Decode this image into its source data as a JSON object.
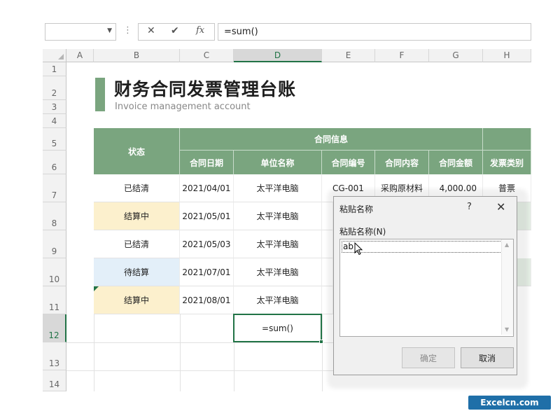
{
  "formula_bar": {
    "name_box": "",
    "dots": "⋮",
    "cancel": "✕",
    "enter": "✔",
    "fx": "fx",
    "formula": "=sum()"
  },
  "columns": [
    "A",
    "B",
    "C",
    "D",
    "E",
    "F",
    "G",
    "H"
  ],
  "selected_column": "D",
  "rows": [
    "1",
    "2",
    "3",
    "4",
    "5",
    "6",
    "7",
    "8",
    "9",
    "10",
    "11",
    "12",
    "13",
    "14"
  ],
  "selected_row": "12",
  "sheet": {
    "title": "财务合同发票管理台账",
    "subtitle": "Invoice management account",
    "group_header": "合同信息",
    "headers": [
      "状态",
      "合同日期",
      "单位名称",
      "合同编号",
      "合同内容",
      "合同金额",
      "发票类别"
    ],
    "records": [
      {
        "status": "已结清",
        "date": "2021/04/01",
        "unit": "太平洋电脑",
        "no": "CG-001",
        "content": "采购原材料",
        "amount": "4,000.00",
        "type": "普票",
        "status_color": "none"
      },
      {
        "status": "结算中",
        "date": "2021/05/01",
        "unit": "太平洋电脑",
        "no": "",
        "content": "",
        "amount": "",
        "type": "",
        "status_color": "yellow"
      },
      {
        "status": "已结清",
        "date": "2021/05/03",
        "unit": "太平洋电脑",
        "no": "",
        "content": "",
        "amount": "",
        "type": "",
        "status_color": "none"
      },
      {
        "status": "待结算",
        "date": "2021/07/01",
        "unit": "太平洋电脑",
        "no": "",
        "content": "",
        "amount": "",
        "type": "",
        "status_color": "blue"
      },
      {
        "status": "结算中",
        "date": "2021/08/01",
        "unit": "太平洋电脑",
        "no": "",
        "content": "",
        "amount": "",
        "type": "",
        "status_color": "yellow"
      }
    ],
    "active_cell_text": "=sum()"
  },
  "dialog": {
    "title": "粘贴名称",
    "help": "?",
    "close": "✕",
    "list_label": "粘贴名称(N)",
    "list_items": [
      "ab"
    ],
    "ok": "确定",
    "cancel": "取消"
  },
  "watermark": "Excelcn.com",
  "colors": {
    "accent": "#7aa57f",
    "excel_green": "#217346",
    "yellow_status": "#fcf0cd",
    "blue_status": "#e3eff9"
  }
}
